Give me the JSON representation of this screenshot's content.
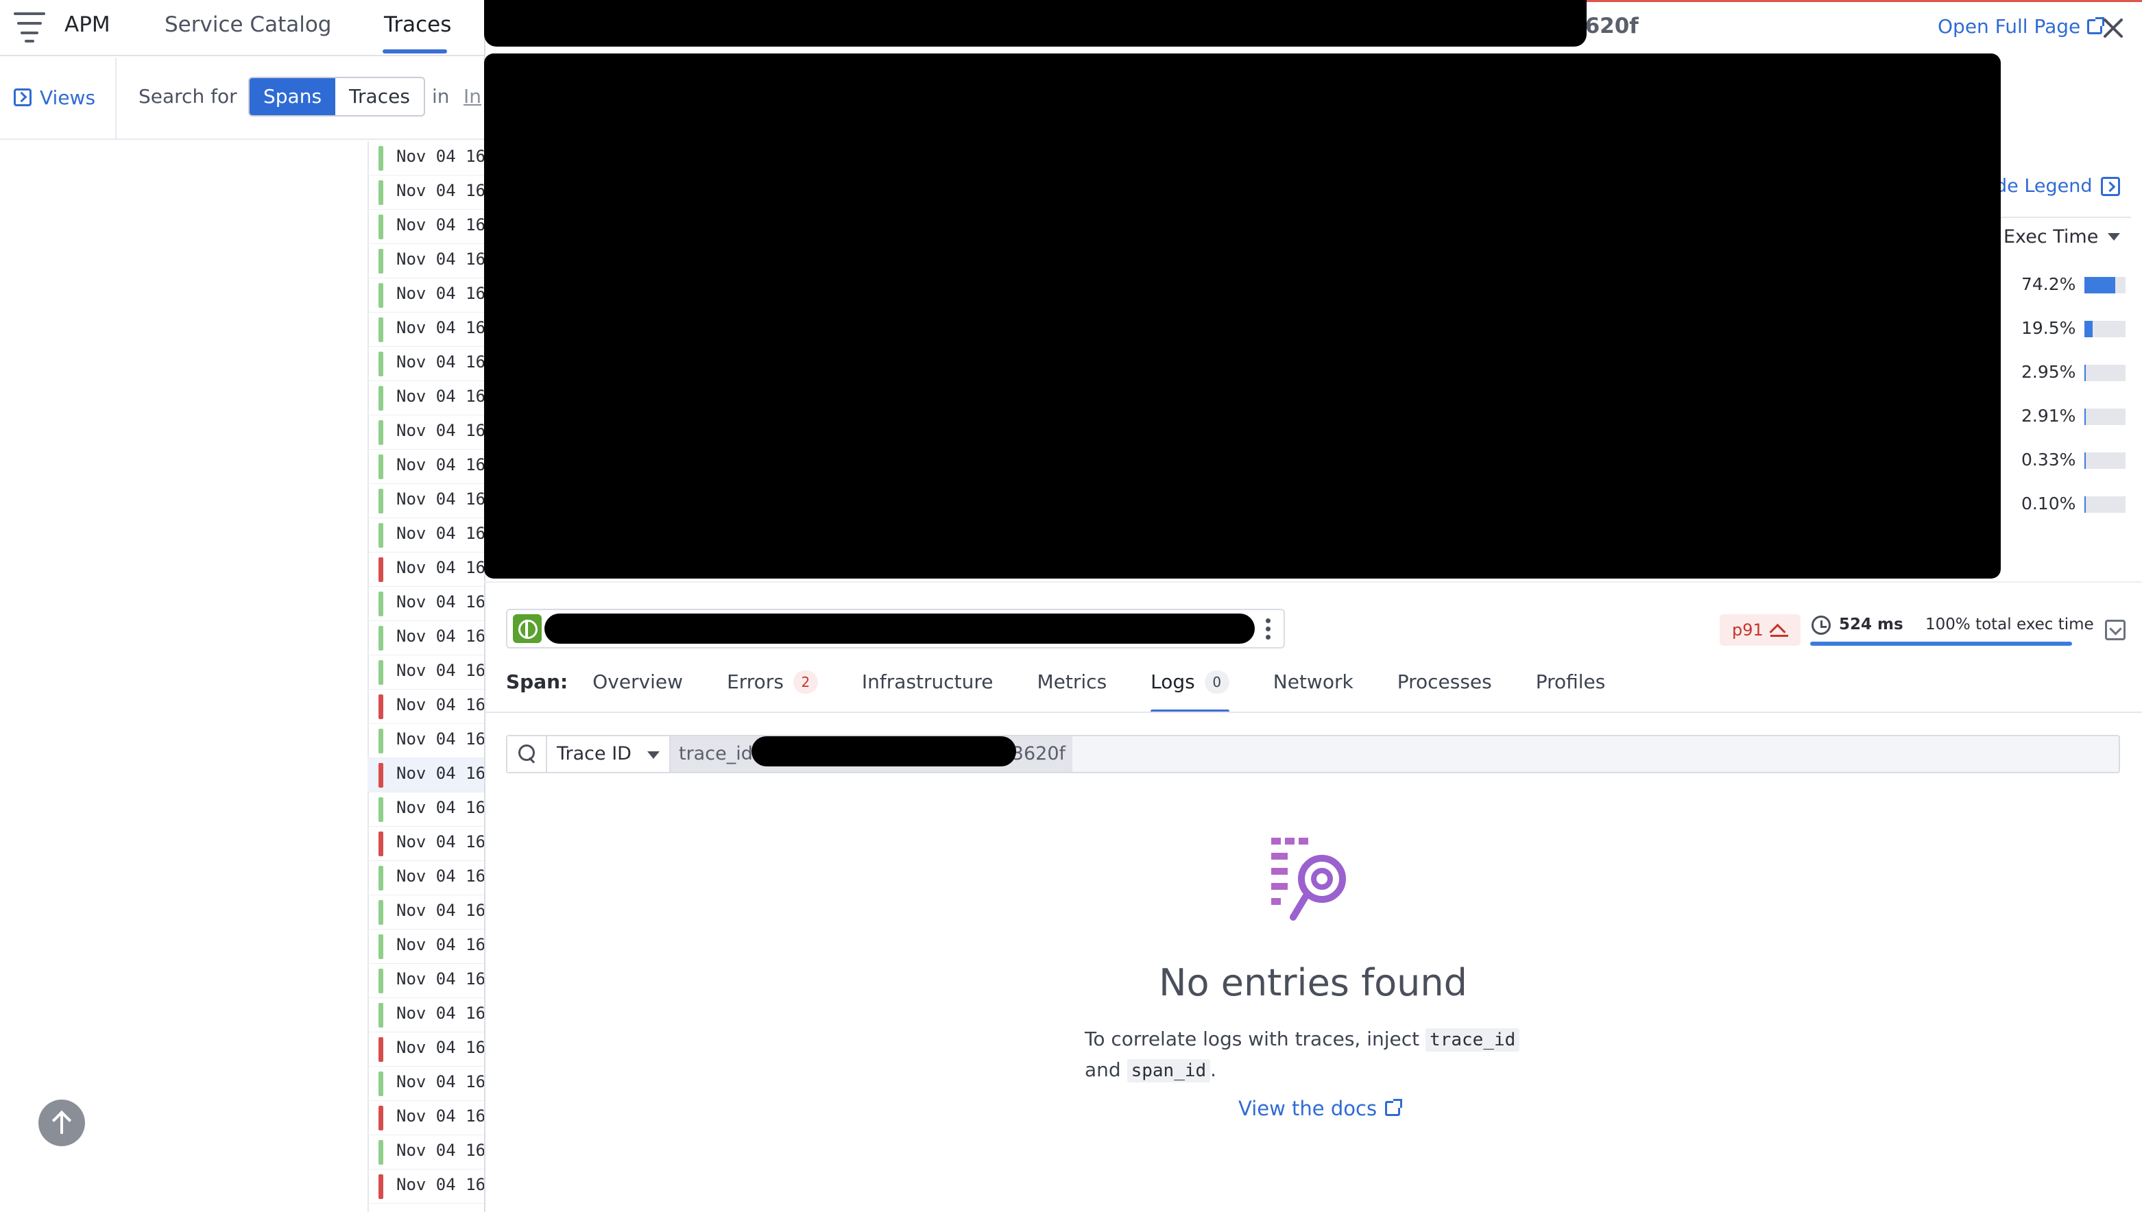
{
  "nav": {
    "app": "APM",
    "items": [
      "Service Catalog",
      "Traces"
    ]
  },
  "search": {
    "views_label": "Views",
    "search_for": "Search for",
    "modes": [
      "Spans",
      "Traces"
    ],
    "active_mode": "Spans",
    "in_label": "in",
    "index_stub": "In"
  },
  "rows": [
    {
      "date": "Nov 04 16",
      "status": "ok"
    },
    {
      "date": "Nov 04 16",
      "status": "ok"
    },
    {
      "date": "Nov 04 16",
      "status": "ok"
    },
    {
      "date": "Nov 04 16",
      "status": "ok"
    },
    {
      "date": "Nov 04 16",
      "status": "ok"
    },
    {
      "date": "Nov 04 16",
      "status": "ok"
    },
    {
      "date": "Nov 04 16",
      "status": "ok"
    },
    {
      "date": "Nov 04 16",
      "status": "ok"
    },
    {
      "date": "Nov 04 16",
      "status": "ok"
    },
    {
      "date": "Nov 04 16",
      "status": "ok"
    },
    {
      "date": "Nov 04 16",
      "status": "ok"
    },
    {
      "date": "Nov 04 16",
      "status": "ok"
    },
    {
      "date": "Nov 04 16",
      "status": "err"
    },
    {
      "date": "Nov 04 16",
      "status": "ok"
    },
    {
      "date": "Nov 04 16",
      "status": "ok"
    },
    {
      "date": "Nov 04 16",
      "status": "ok"
    },
    {
      "date": "Nov 04 16",
      "status": "err"
    },
    {
      "date": "Nov 04 16",
      "status": "ok"
    },
    {
      "date": "Nov 04 16",
      "status": "err",
      "selected": true
    },
    {
      "date": "Nov 04 16",
      "status": "ok"
    },
    {
      "date": "Nov 04 16",
      "status": "err"
    },
    {
      "date": "Nov 04 16",
      "status": "ok"
    },
    {
      "date": "Nov 04 16",
      "status": "ok"
    },
    {
      "date": "Nov 04 16",
      "status": "ok"
    },
    {
      "date": "Nov 04 16",
      "status": "ok"
    },
    {
      "date": "Nov 04 16",
      "status": "ok"
    },
    {
      "date": "Nov 04 16",
      "status": "err"
    },
    {
      "date": "Nov 04 16",
      "status": "ok"
    },
    {
      "date": "Nov 04 16",
      "status": "err"
    },
    {
      "date": "Nov 04 16",
      "status": "ok"
    },
    {
      "date": "Nov 04 16",
      "status": "err"
    }
  ],
  "panel": {
    "trace_id_tail": "3620f",
    "open_full_page": "Open Full Page",
    "legend_toggle": "de Legend",
    "exec_time_header": "Exec Time",
    "exec_breakdown": [
      {
        "pct": "74.2%",
        "fraction": 0.742
      },
      {
        "pct": "19.5%",
        "fraction": 0.195
      },
      {
        "pct": "2.95%",
        "fraction": 0.0295
      },
      {
        "pct": "2.91%",
        "fraction": 0.0291
      },
      {
        "pct": "0.33%",
        "fraction": 0.0033
      },
      {
        "pct": "0.10%",
        "fraction": 0.001
      }
    ]
  },
  "span": {
    "percentile": "p91",
    "duration": "524 ms",
    "total_exec": "100% total exec time",
    "label": "Span:",
    "tabs": [
      {
        "label": "Overview"
      },
      {
        "label": "Errors",
        "count": "2",
        "badge": "red"
      },
      {
        "label": "Infrastructure"
      },
      {
        "label": "Metrics"
      },
      {
        "label": "Logs",
        "count": "0",
        "badge": "grey",
        "active": true
      },
      {
        "label": "Network"
      },
      {
        "label": "Processes"
      },
      {
        "label": "Profiles"
      }
    ]
  },
  "logs": {
    "query_field": "Trace ID",
    "query_prefix": "trace_id:",
    "query_tail": "3620f",
    "empty_title": "No entries found",
    "empty_desc_1": "To correlate logs with traces, inject",
    "code_trace": "trace_id",
    "and": "and",
    "code_span": "span_id",
    "period": ".",
    "docs_link": "View the docs"
  },
  "colors": {
    "accent": "#2f6bd4",
    "ok": "#8fcf8a",
    "error": "#d64d4d",
    "icon_purple": "#b067c9"
  }
}
